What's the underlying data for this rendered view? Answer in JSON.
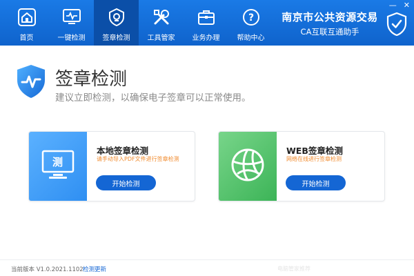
{
  "window": {
    "min_label": "—",
    "close_label": "✕"
  },
  "nav": {
    "items": [
      {
        "label": "首页",
        "icon": "home-icon"
      },
      {
        "label": "一键检测",
        "icon": "monitor-pulse-icon"
      },
      {
        "label": "签章检测",
        "icon": "seal-check-icon",
        "active": true
      },
      {
        "label": "工具管家",
        "icon": "tools-icon"
      },
      {
        "label": "业务办理",
        "icon": "briefcase-icon"
      },
      {
        "label": "帮助中心",
        "icon": "help-icon"
      }
    ]
  },
  "brand": {
    "title": "南京市公共资源交易",
    "subtitle": "CA互联互通助手"
  },
  "main": {
    "title": "签章检测",
    "subtitle": "建议立即检测，以确保电子签章可以正常使用。"
  },
  "cards": {
    "local": {
      "title": "本地签章检测",
      "desc": "请手动导入PDF文件进行签章检测",
      "button": "开始检测",
      "icon_char": "测"
    },
    "web": {
      "title": "WEB签章检测",
      "desc": "网络在线进行签章检测",
      "button": "开始检测"
    }
  },
  "footer": {
    "version": "当前版本 V1.0.2021.1102",
    "update": "检测更新",
    "faint": "电脑管家推荐"
  },
  "colors": {
    "header": "#1170d9",
    "active_tab": "#0b4fa8",
    "button": "#1466d4",
    "desc": "#f08a2c",
    "local_card": "#3f9ff6",
    "web_card": "#53c067"
  }
}
